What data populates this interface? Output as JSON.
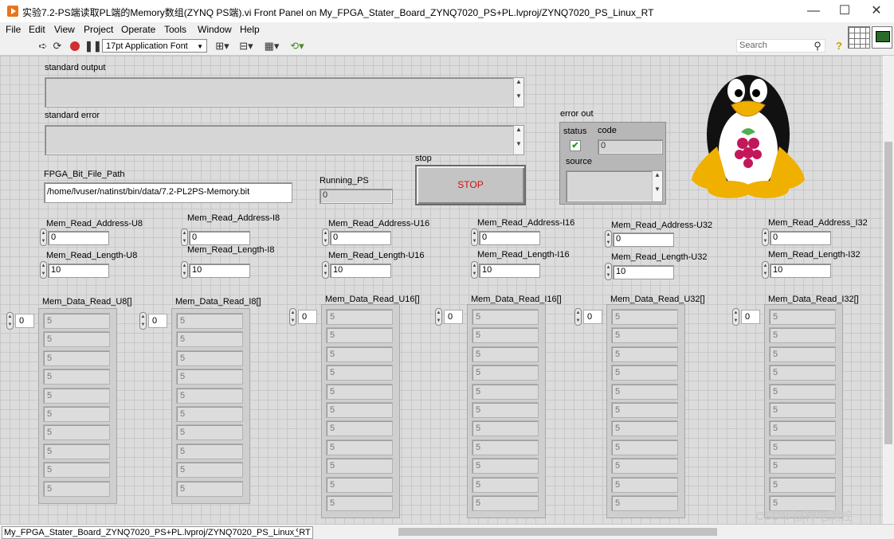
{
  "window": {
    "title": "实验7.2-PS端读取PL端的Memory数组(ZYNQ PS端).vi Front Panel on My_FPGA_Stater_Board_ZYNQ7020_PS+PL.lvproj/ZYNQ7020_PS_Linux_RT",
    "minimize": "—",
    "maximize": "☐",
    "close": "✕"
  },
  "menu": [
    "File",
    "Edit",
    "View",
    "Project",
    "Operate",
    "Tools",
    "Window",
    "Help"
  ],
  "toolbar": {
    "font": "17pt Application Font",
    "search_placeholder": "Search"
  },
  "panel": {
    "std_out_label": "standard output",
    "std_err_label": "standard error",
    "fpga_path_label": "FPGA_Bit_File_Path",
    "fpga_path_value": "/home/lvuser/natinst/bin/data/7.2-PL2PS-Memory.bit",
    "running_label": "Running_PS",
    "running_value": "0",
    "stop_label": "stop",
    "stop_button": "STOP",
    "error_out": {
      "label": "error out",
      "status_label": "status",
      "code_label": "code",
      "code_value": "0",
      "source_label": "source",
      "status_mark": "✔"
    }
  },
  "params": [
    {
      "addr_label": "Mem_Read_Address-U8",
      "addr": "0",
      "len_label": "Mem_Read_Length-U8",
      "len": "10"
    },
    {
      "addr_label": "Mem_Read_Address-I8",
      "addr": "0",
      "len_label": "Mem_Read_Length-I8",
      "len": "10"
    },
    {
      "addr_label": "Mem_Read_Address-U16",
      "addr": "0",
      "len_label": "Mem_Read_Length-U16",
      "len": "10"
    },
    {
      "addr_label": "Mem_Read_Address-I16",
      "addr": "0",
      "len_label": "Mem_Read_Length-I16",
      "len": "10"
    },
    {
      "addr_label": "Mem_Read_Address-U32",
      "addr": "0",
      "len_label": "Mem_Read_Length-U32",
      "len": "10"
    },
    {
      "addr_label": "Mem_Read_Address_I32",
      "addr": "0",
      "len_label": "Mem_Read_Length-I32",
      "len": "10"
    }
  ],
  "arrays": [
    {
      "label": "Mem_Data_Read_U8[]",
      "index": "0",
      "values": [
        "5",
        "5",
        "5",
        "5",
        "5",
        "5",
        "5",
        "5",
        "5",
        "5"
      ]
    },
    {
      "label": "Mem_Data_Read_I8[]",
      "index": "0",
      "values": [
        "5",
        "5",
        "5",
        "5",
        "5",
        "5",
        "5",
        "5",
        "5",
        "5"
      ]
    },
    {
      "label": "Mem_Data_Read_U16[]",
      "index": "0",
      "values": [
        "5",
        "5",
        "5",
        "5",
        "5",
        "5",
        "5",
        "5",
        "5",
        "5",
        "5"
      ]
    },
    {
      "label": "Mem_Data_Read_I16[]",
      "index": "0",
      "values": [
        "5",
        "5",
        "5",
        "5",
        "5",
        "5",
        "5",
        "5",
        "5",
        "5",
        "5"
      ]
    },
    {
      "label": "Mem_Data_Read_U32[]",
      "index": "0",
      "values": [
        "5",
        "5",
        "5",
        "5",
        "5",
        "5",
        "5",
        "5",
        "5",
        "5",
        "5"
      ]
    },
    {
      "label": "Mem_Data_Read_I32[]",
      "index": "0",
      "values": [
        "5",
        "5",
        "5",
        "5",
        "5",
        "5",
        "5",
        "5",
        "5",
        "5",
        "5"
      ]
    }
  ],
  "statusbar": {
    "path": "My_FPGA_Stater_Board_ZYNQ7020_PS+PL.lvproj/ZYNQ7020_PS_Linux_RT",
    "watermark": "CSDN @神电测控"
  }
}
